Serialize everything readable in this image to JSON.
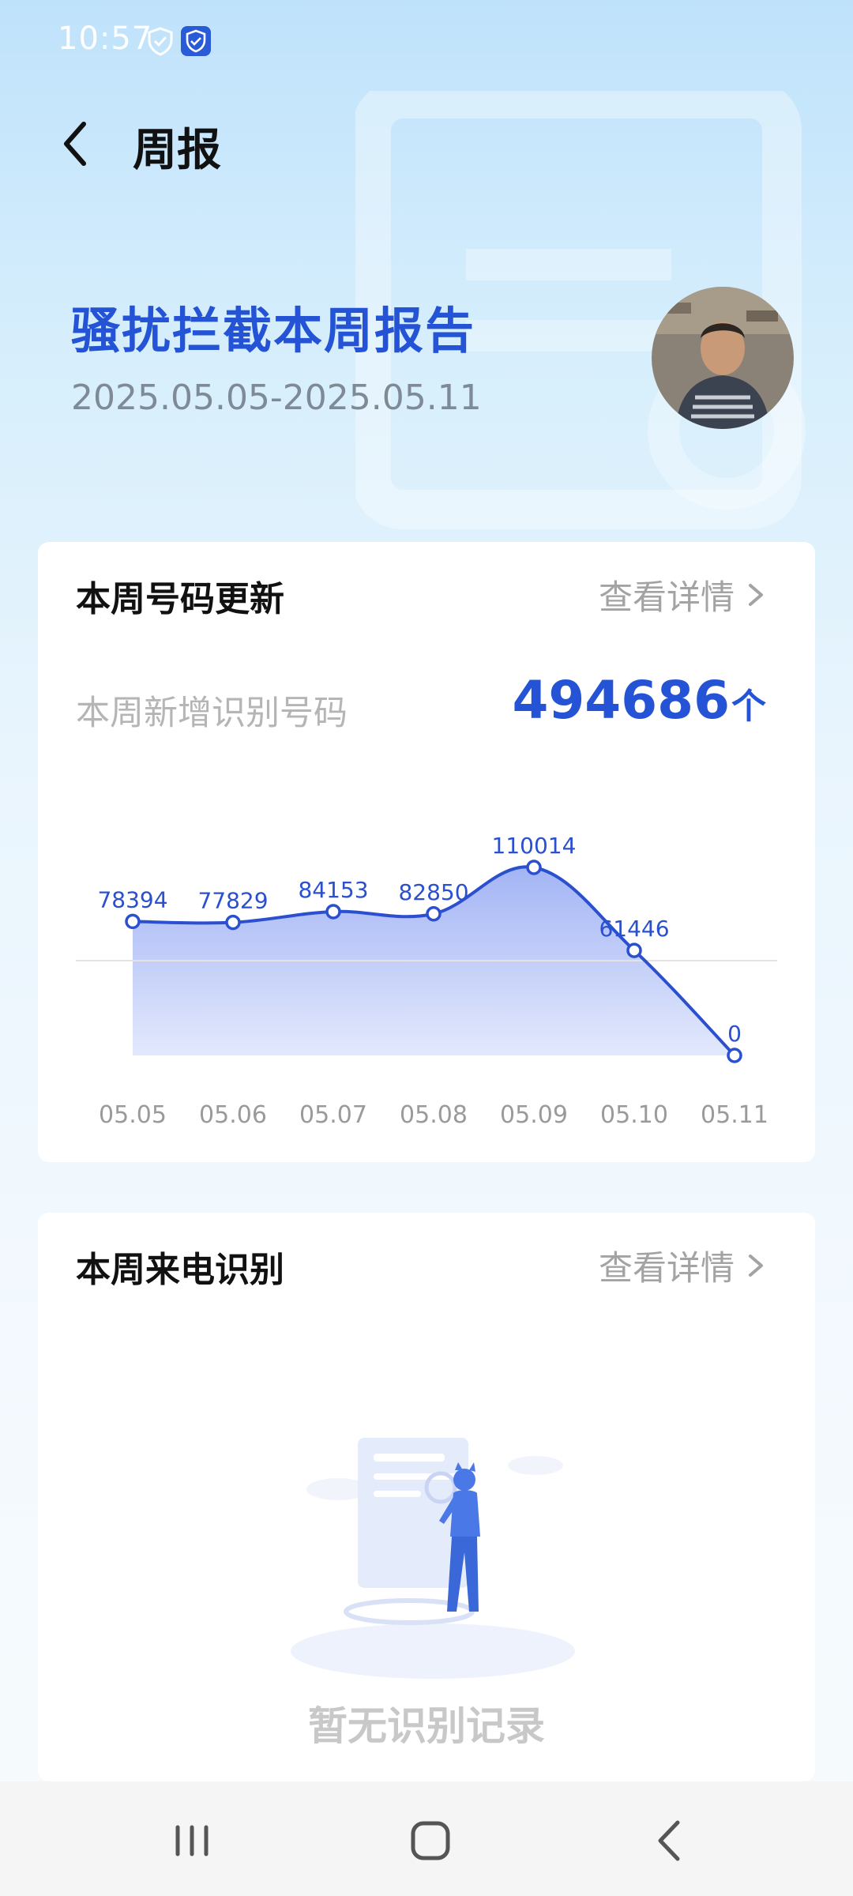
{
  "status_bar": {
    "time": "10:57"
  },
  "header": {
    "title": "周报"
  },
  "hero": {
    "title": "骚扰拦截本周报告",
    "date_range": "2025.05.05-2025.05.11"
  },
  "card_numbers": {
    "title": "本周号码更新",
    "detail_label": "查看详情",
    "new_label": "本周新增识别号码",
    "new_value": "494686",
    "new_unit": "个"
  },
  "chart_data": {
    "type": "area",
    "categories": [
      "05.05",
      "05.06",
      "05.07",
      "05.08",
      "05.09",
      "05.10",
      "05.11"
    ],
    "values": [
      78394,
      77829,
      84153,
      82850,
      110014,
      61446,
      0
    ],
    "ylim": [
      0,
      110014
    ],
    "line_color": "#2a4fcf",
    "fill_color": "#aebdf6"
  },
  "card_calls": {
    "title": "本周来电识别",
    "detail_label": "查看详情",
    "empty_text": "暂无识别记录"
  },
  "icons": {
    "status": [
      "shield-outline-icon",
      "shield-check-icon"
    ],
    "back": "chevron-left-icon",
    "nav": [
      "recent-apps-icon",
      "home-icon",
      "back-icon"
    ]
  }
}
